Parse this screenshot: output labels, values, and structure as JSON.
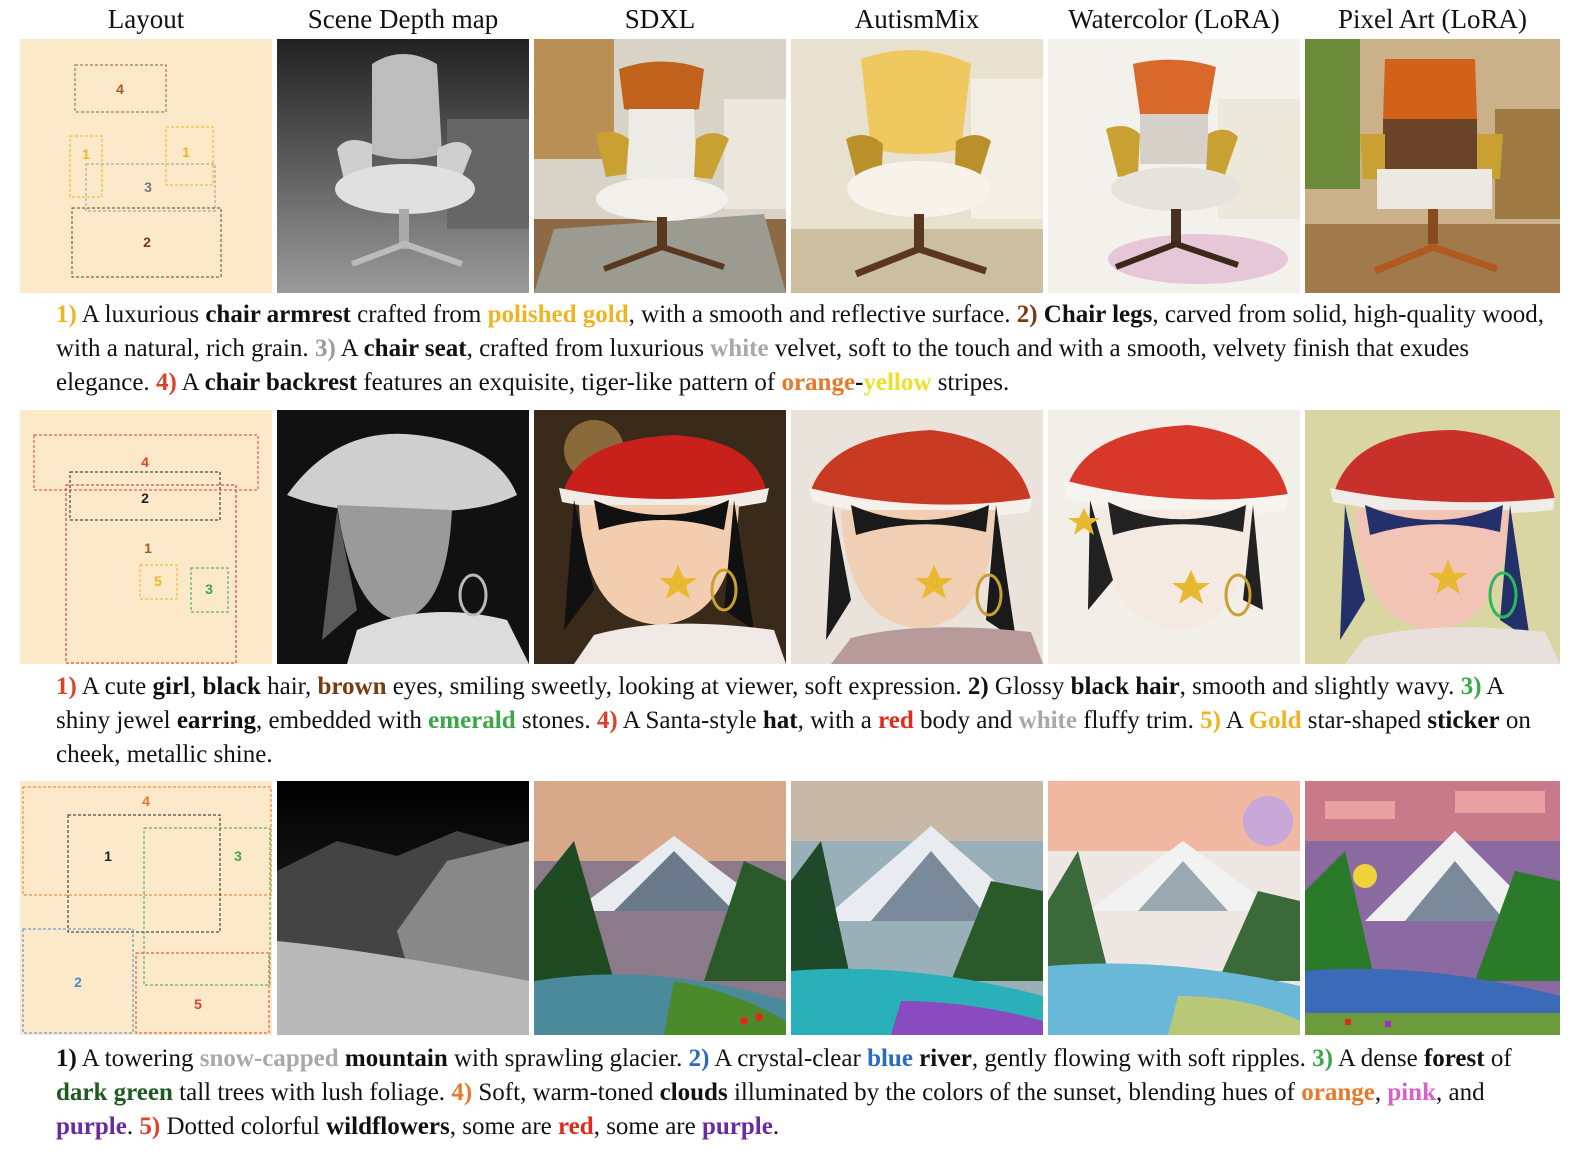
{
  "columns": [
    "Layout",
    "Scene Depth map",
    "SDXL",
    "AutismMix",
    "Watercolor (LoRA)",
    "Pixel Art (LoRA)"
  ],
  "rows": [
    {
      "layout_labels": [
        "4",
        "1",
        "1",
        "3",
        "2"
      ],
      "caption": [
        {
          "t": "1)",
          "c": "#f0b423",
          "b": true
        },
        {
          "t": " A luxurious "
        },
        {
          "t": "chair armrest",
          "b": true
        },
        {
          "t": " crafted from "
        },
        {
          "t": "polished gold",
          "c": "#f0b423",
          "b": true
        },
        {
          "t": ", with a smooth and reflective surface. "
        },
        {
          "t": "2)",
          "c": "#7a3b12",
          "b": true
        },
        {
          "t": " "
        },
        {
          "t": "Chair legs",
          "b": true
        },
        {
          "t": ", carved from solid, high-quality wood, with a natural, rich grain. "
        },
        {
          "t": "3)",
          "c": "#9a9a9a",
          "b": true
        },
        {
          "t": " A "
        },
        {
          "t": "chair seat",
          "b": true
        },
        {
          "t": ", crafted from luxurious "
        },
        {
          "t": "white",
          "c": "#a8a8a8",
          "b": true
        },
        {
          "t": " velvet, soft to the touch and with a smooth, velvety finish that exudes elegance. "
        },
        {
          "t": "4)",
          "c": "#e0402a",
          "b": true
        },
        {
          "t": " A "
        },
        {
          "t": "chair backrest",
          "b": true
        },
        {
          "t": " features an exquisite, tiger-like pattern of "
        },
        {
          "t": "orange",
          "c": "#e8782a",
          "b": true
        },
        {
          "t": "-",
          "b": true
        },
        {
          "t": "yellow",
          "c": "#e8e22a",
          "b": true
        },
        {
          "t": " stripes."
        }
      ]
    },
    {
      "layout_labels": [
        "4",
        "2",
        "1",
        "5",
        "3"
      ],
      "caption": [
        {
          "t": "1)",
          "c": "#e0402a",
          "b": true
        },
        {
          "t": " A cute "
        },
        {
          "t": "girl",
          "b": true
        },
        {
          "t": ", "
        },
        {
          "t": "black",
          "b": true
        },
        {
          "t": " hair, "
        },
        {
          "t": "brown",
          "c": "#7a3b12",
          "b": true
        },
        {
          "t": " eyes, smiling sweetly, looking at viewer, soft expression. "
        },
        {
          "t": "2)",
          "b": true
        },
        {
          "t": " Glossy "
        },
        {
          "t": "black hair",
          "b": true
        },
        {
          "t": ", smooth and slightly wavy. "
        },
        {
          "t": "3)",
          "c": "#3aa845",
          "b": true
        },
        {
          "t": " A shiny jewel "
        },
        {
          "t": "earring",
          "b": true
        },
        {
          "t": ", embedded with "
        },
        {
          "t": "emerald",
          "c": "#3aa845",
          "b": true
        },
        {
          "t": " stones. "
        },
        {
          "t": "4)",
          "c": "#e0402a",
          "b": true
        },
        {
          "t": " A Santa-style "
        },
        {
          "t": "hat",
          "b": true
        },
        {
          "t": ", with a "
        },
        {
          "t": "red",
          "c": "#e02a1a",
          "b": true
        },
        {
          "t": " body and "
        },
        {
          "t": "white",
          "c": "#a8a8a8",
          "b": true
        },
        {
          "t": " fluffy trim. "
        },
        {
          "t": "5)",
          "c": "#f0b423",
          "b": true
        },
        {
          "t": " A "
        },
        {
          "t": "Gold",
          "c": "#f0b423",
          "b": true
        },
        {
          "t": " star-shaped "
        },
        {
          "t": "sticker",
          "b": true
        },
        {
          "t": " on cheek, metallic shine."
        }
      ]
    },
    {
      "layout_labels": [
        "4",
        "1",
        "3",
        "2",
        "5"
      ],
      "caption": [
        {
          "t": "1)",
          "b": true
        },
        {
          "t": " A towering "
        },
        {
          "t": "snow-capped",
          "c": "#a8a8a8",
          "b": true
        },
        {
          "t": " "
        },
        {
          "t": "mountain",
          "b": true
        },
        {
          "t": " with sprawling glacier. "
        },
        {
          "t": "2)",
          "c": "#2a6ac0",
          "b": true
        },
        {
          "t": " A crystal-clear "
        },
        {
          "t": "blue",
          "c": "#2a6ac0",
          "b": true
        },
        {
          "t": " "
        },
        {
          "t": "river",
          "b": true
        },
        {
          "t": ", gently flowing with soft ripples. "
        },
        {
          "t": "3)",
          "c": "#3aa845",
          "b": true
        },
        {
          "t": " A dense "
        },
        {
          "t": "forest",
          "b": true
        },
        {
          "t": " of "
        },
        {
          "t": "dark green",
          "c": "#1f5a22",
          "b": true
        },
        {
          "t": " tall trees with lush foliage. "
        },
        {
          "t": "4)",
          "c": "#e8782a",
          "b": true
        },
        {
          "t": " Soft, warm-toned "
        },
        {
          "t": "clouds",
          "b": true
        },
        {
          "t": " illuminated by the colors of the sunset, blending hues of "
        },
        {
          "t": "orange",
          "c": "#e8782a",
          "b": true
        },
        {
          "t": ", "
        },
        {
          "t": "pink",
          "c": "#d860c8",
          "b": true
        },
        {
          "t": ", and "
        },
        {
          "t": "purple",
          "c": "#6a2aa0",
          "b": true
        },
        {
          "t": ". "
        },
        {
          "t": "5)",
          "c": "#e0402a",
          "b": true
        },
        {
          "t": " Dotted colorful "
        },
        {
          "t": "wildflowers",
          "b": true
        },
        {
          "t": ", some are "
        },
        {
          "t": "red",
          "c": "#e02a1a",
          "b": true
        },
        {
          "t": ", some are "
        },
        {
          "t": "purple",
          "c": "#6a2aa0",
          "b": true
        },
        {
          "t": "."
        }
      ]
    }
  ]
}
